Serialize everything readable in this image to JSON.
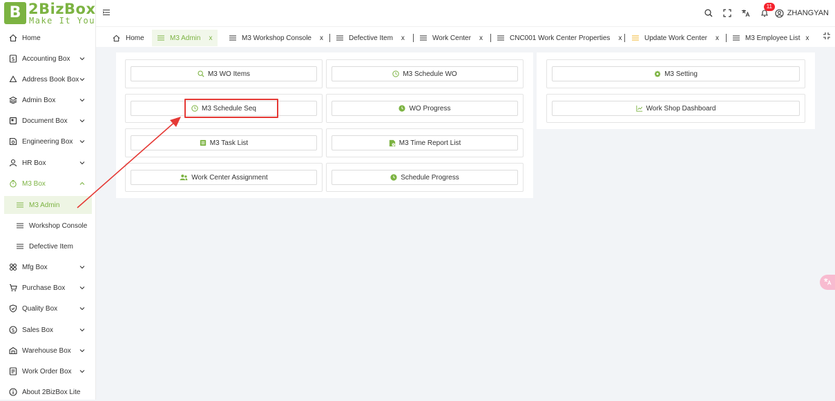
{
  "app": {
    "logo_mark": "B",
    "logo_text": "2BizBox",
    "logo_sub": "Make It Yours"
  },
  "sidebar": {
    "home": "Home",
    "items": [
      {
        "label": "Accounting Box",
        "icon": "dollar-doc-icon"
      },
      {
        "label": "Address Book Box",
        "icon": "recycle-icon"
      },
      {
        "label": "Admin Box",
        "icon": "layers-icon"
      },
      {
        "label": "Document Box",
        "icon": "document-icon"
      },
      {
        "label": "Engineering Box",
        "icon": "gear-doc-icon"
      },
      {
        "label": "HR Box",
        "icon": "person-icon"
      },
      {
        "label": "M3 Box",
        "icon": "stopwatch-icon"
      }
    ],
    "m3_sub": [
      {
        "label": "M3 Admin"
      },
      {
        "label": "Workshop Console"
      },
      {
        "label": "Defective Item"
      }
    ],
    "items_after": [
      {
        "label": "Mfg Box",
        "icon": "link-icon"
      },
      {
        "label": "Purchase Box",
        "icon": "cart-icon"
      },
      {
        "label": "Quality Box",
        "icon": "shield-check-icon"
      },
      {
        "label": "Sales Box",
        "icon": "dollar-circle-icon"
      },
      {
        "label": "Warehouse Box",
        "icon": "warehouse-icon"
      },
      {
        "label": "Work Order Box",
        "icon": "work-order-icon"
      },
      {
        "label": "About 2BizBox Lite",
        "icon": "info-icon"
      }
    ]
  },
  "topbar": {
    "notification_count": "11",
    "username": "ZHANGYAN"
  },
  "tabs": [
    {
      "label": "Home"
    },
    {
      "label": "M3 Admin",
      "close": "x"
    },
    {
      "label": "M3 Workshop Console",
      "close": "x"
    },
    {
      "label": "Defective Item",
      "close": "x"
    },
    {
      "label": "Work Center",
      "close": "x"
    },
    {
      "label": "CNC001 Work Center Properties",
      "close": "x"
    },
    {
      "label": "Update Work Center",
      "close": "x"
    },
    {
      "label": "M3 Employee List",
      "close": "x"
    }
  ],
  "left_panel": {
    "buttons": [
      {
        "label": "M3 WO Items",
        "icon": "search-icon"
      },
      {
        "label": "M3 Schedule WO",
        "icon": "clock-icon"
      },
      {
        "label": "M3 Schedule Seq",
        "icon": "clock-icon"
      },
      {
        "label": "WO Progress",
        "icon": "clock-filled-icon"
      },
      {
        "label": "M3 Task List",
        "icon": "list-icon"
      },
      {
        "label": "M3 Time Report List",
        "icon": "report-icon"
      },
      {
        "label": "Work Center Assignment",
        "icon": "users-icon"
      },
      {
        "label": "Schedule Progress",
        "icon": "clock-filled-icon"
      }
    ]
  },
  "right_panel": {
    "buttons": [
      {
        "label": "M3 Setting",
        "icon": "gear-icon"
      },
      {
        "label": "Work Shop Dashboard",
        "icon": "line-chart-icon"
      }
    ]
  },
  "colors": {
    "accent": "#7cb342",
    "highlight": "#e53935"
  }
}
